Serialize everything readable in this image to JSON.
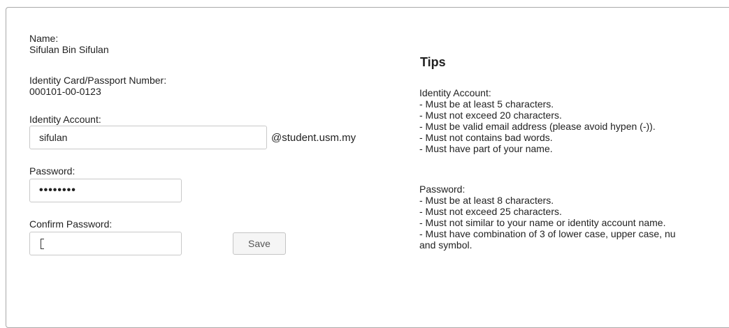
{
  "form": {
    "name_label": "Name:",
    "name_value": "Sifulan Bin Sifulan",
    "id_label": "Identity Card/Passport Number:",
    "id_value": "000101-00-0123",
    "account_label": "Identity Account:",
    "account_value": "sifulan",
    "account_suffix": "@student.usm.my",
    "password_label": "Password:",
    "password_value": "••••••••",
    "confirm_label": "Confirm Password:",
    "confirm_value": "",
    "save_label": "Save"
  },
  "tips": {
    "title": "Tips",
    "account_heading": "Identity Account:",
    "account_rules": [
      "- Must be at least 5 characters.",
      "- Must not exceed 20 characters.",
      "- Must be valid email address (please avoid hypen (-)).",
      "- Must not contains bad words.",
      "- Must have part of your name."
    ],
    "password_heading": "Password:",
    "password_rules": [
      "- Must be at least 8 characters.",
      "- Must not exceed 25 characters.",
      "- Must not similar to your name or identity account name.",
      "- Must have combination of 3 of lower case, upper case, nu",
      "and symbol."
    ]
  }
}
